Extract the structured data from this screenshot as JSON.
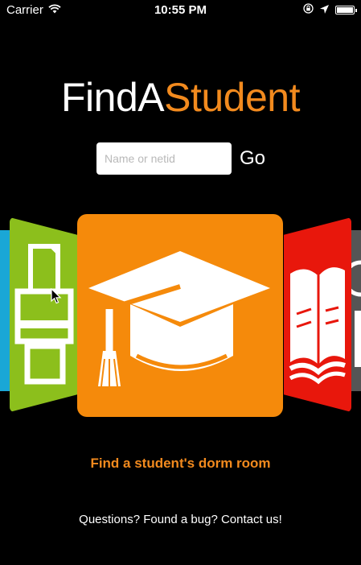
{
  "status_bar": {
    "carrier": "Carrier",
    "time": "10:55 PM",
    "icons": [
      "wifi-icon",
      "orientation-lock-icon",
      "location-icon",
      "battery-icon"
    ],
    "battery_level": 1.0
  },
  "header": {
    "title_part1": "FindA",
    "title_part2": "Student"
  },
  "search": {
    "placeholder": "Name or netid",
    "value": "",
    "go_label": "Go"
  },
  "carousel": {
    "cards": [
      {
        "name": "partial-card",
        "icon": "unknown",
        "color": "#1aa7d6"
      },
      {
        "name": "printer-card",
        "icon": "printer-icon",
        "color": "#8cbf1c"
      },
      {
        "name": "student-card",
        "icon": "graduation-cap-icon",
        "color": "#f58a0b"
      },
      {
        "name": "library-card",
        "icon": "book-icon",
        "color": "#e8170c"
      },
      {
        "name": "partial-card",
        "icon": "unknown",
        "color": "#555555"
      }
    ],
    "active_index": 2,
    "caption": "Find a student's dorm room"
  },
  "footer": {
    "contact_text": "Questions? Found a bug? Contact us!"
  },
  "colors": {
    "accent": "#f28a1e",
    "background": "#000000"
  }
}
